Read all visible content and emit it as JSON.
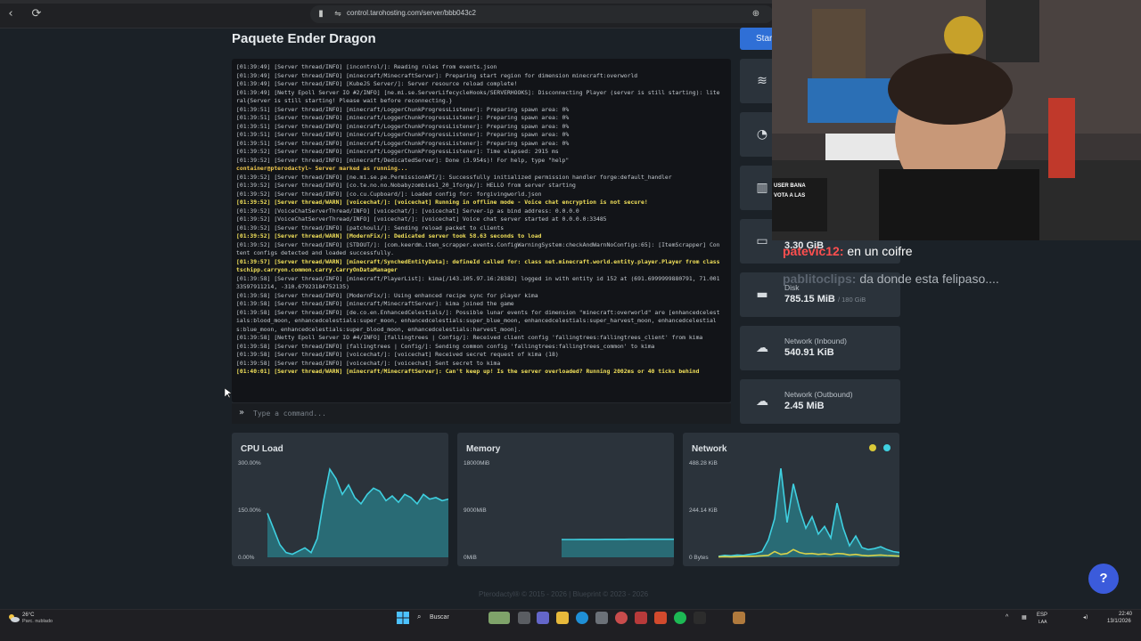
{
  "browser": {
    "url": "control.tarohosting.com/server/bbb043c2"
  },
  "page": {
    "title": "Paquete Ender Dragon",
    "start_label": "Start"
  },
  "console": {
    "lines": [
      {
        "text": "[01:39:49] [Server thread/INFO] [incontrol/]: Reading rules from events.json",
        "type": "info"
      },
      {
        "text": "[01:39:49] [Server thread/INFO] [minecraft/MinecraftServer]: Preparing start region for dimension minecraft:overworld",
        "type": "info"
      },
      {
        "text": "[01:39:49] [Server thread/INFO] [KubeJS Server/]: Server resource reload complete!",
        "type": "info"
      },
      {
        "text": "[01:39:49] [Netty Epoll Server IO #2/INFO] [ne.mi.se.ServerLifecycleHooks/SERVERHOOKS]: Disconnecting Player (server is still starting): literal{Server is still starting! Please wait before reconnecting.}",
        "type": "info"
      },
      {
        "text": "[01:39:51] [Server thread/INFO] [minecraft/LoggerChunkProgressListener]: Preparing spawn area: 0%",
        "type": "info"
      },
      {
        "text": "[01:39:51] [Server thread/INFO] [minecraft/LoggerChunkProgressListener]: Preparing spawn area: 0%",
        "type": "info"
      },
      {
        "text": "[01:39:51] [Server thread/INFO] [minecraft/LoggerChunkProgressListener]: Preparing spawn area: 0%",
        "type": "info"
      },
      {
        "text": "[01:39:51] [Server thread/INFO] [minecraft/LoggerChunkProgressListener]: Preparing spawn area: 0%",
        "type": "info"
      },
      {
        "text": "[01:39:51] [Server thread/INFO] [minecraft/LoggerChunkProgressListener]: Preparing spawn area: 0%",
        "type": "info"
      },
      {
        "text": "[01:39:52] [Server thread/INFO] [minecraft/LoggerChunkProgressListener]: Time elapsed: 2915 ms",
        "type": "info"
      },
      {
        "text": "[01:39:52] [Server thread/INFO] [minecraft/DedicatedServer]: Done (3.954s)! For help, type \"help\"",
        "type": "info"
      },
      {
        "text": "container@pterodactyl~ Server marked as running...",
        "type": "prompt"
      },
      {
        "text": "[01:39:52] [Server thread/INFO] [ne.mi.se.pe.PermissionAPI/]: Successfully initialized permission handler forge:default_handler",
        "type": "info"
      },
      {
        "text": "[01:39:52] [Server thread/INFO] [co.te.no.no.Nobabyzombies1_20_1forge/]: HELLO from server starting",
        "type": "info"
      },
      {
        "text": "[01:39:52] [Server thread/INFO] [co.cu.Cupboard/]: Loaded config for: forgivingworld.json",
        "type": "info"
      },
      {
        "text": "[01:39:52] [Server thread/WARN] [voicechat/]: [voicechat] Running in offline mode - Voice chat encryption is not secure!",
        "type": "warn"
      },
      {
        "text": "[01:39:52] [VoiceChatServerThread/INFO] [voicechat/]: [voicechat] Server-ip as bind address: 0.0.0.0",
        "type": "info"
      },
      {
        "text": "[01:39:52] [VoiceChatServerThread/INFO] [voicechat/]: [voicechat] Voice chat server started at 0.0.0.0:33485",
        "type": "info"
      },
      {
        "text": "[01:39:52] [Server thread/INFO] [patchouli/]: Sending reload packet to clients",
        "type": "info"
      },
      {
        "text": "[01:39:52] [Server thread/WARN] [ModernFix/]: Dedicated server took 58.63 seconds to load",
        "type": "warn"
      },
      {
        "text": "[01:39:52] [Server thread/INFO] [STDOUT/]: [com.keerdm.item_scrapper.events.ConfigWarningSystem:checkAndWarnNoConfigs:65]: [ItemScrapper] Content configs detected and loaded successfully.",
        "type": "info"
      },
      {
        "text": "[01:39:57] [Server thread/WARN] [minecraft/SynchedEntityData]: defineId called for: class net.minecraft.world.entity.player.Player from class tschipp.carryon.common.carry.CarryOnDataManager",
        "type": "warn"
      },
      {
        "text": "[01:39:58] [Server thread/INFO] [minecraft/PlayerList]: kima[/143.105.97.16:28382] logged in with entity id 152 at (691.6999999880791, 71.00133597911214, -310.67923184752135)",
        "type": "info"
      },
      {
        "text": "[01:39:58] [Server thread/INFO] [ModernFix/]: Using enhanced recipe sync for player kima",
        "type": "info"
      },
      {
        "text": "[01:39:58] [Server thread/INFO] [minecraft/MinecraftServer]: kima joined the game",
        "type": "info"
      },
      {
        "text": "[01:39:58] [Server thread/INFO] [de.co.en.EnhancedCelestials/]: Possible lunar events for dimension \"minecraft:overworld\" are [enhancedcelestials:blood_moon, enhancedcelestials:super_moon, enhancedcelestials:super_blue_moon, enhancedcelestials:super_harvest_moon, enhancedcelestials:blue_moon, enhancedcelestials:super_blood_moon, enhancedcelestials:harvest_moon].",
        "type": "info"
      },
      {
        "text": "[01:39:58] [Netty Epoll Server IO #4/INFO] [fallingtrees | Config/]: Received client config 'fallingtrees:fallingtrees_client' from kima",
        "type": "info"
      },
      {
        "text": "[01:39:58] [Server thread/INFO] [fallingtrees | Config/]: Sending common config 'fallingtrees:fallingtrees_common' to kima",
        "type": "info"
      },
      {
        "text": "[01:39:58] [Server thread/INFO] [voicechat/]: [voicechat] Received secret request of kima (18)",
        "type": "info"
      },
      {
        "text": "[01:39:58] [Server thread/INFO] [voicechat/]: [voicechat] Sent secret to kima",
        "type": "info"
      },
      {
        "text": "[01:40:01] [Server thread/WARN] [minecraft/MinecraftServer]: Can't keep up! Is the server overloaded? Running 2002ms or 40 ticks behind",
        "type": "warn"
      }
    ],
    "command_placeholder": "Type a command..."
  },
  "stats": [
    {
      "name": "stat-card-address",
      "icon": "wifi-icon",
      "label": "",
      "value": "",
      "sub": ""
    },
    {
      "name": "stat-card-uptime",
      "icon": "clock-icon",
      "label": "",
      "value": "",
      "sub": ""
    },
    {
      "name": "stat-card-cpu",
      "icon": "chip-icon",
      "label": "",
      "value": "",
      "sub": ""
    },
    {
      "name": "stat-card-memory",
      "icon": "memory-icon",
      "label": "",
      "value": "3.30 GiB",
      "sub": ""
    },
    {
      "name": "stat-card-disk",
      "icon": "hdd-icon",
      "label": "Disk",
      "value": "785.15 MiB",
      "sub": "/ 180 GiB"
    },
    {
      "name": "stat-card-network-in",
      "icon": "cloud-download-icon",
      "label": "Network (Inbound)",
      "value": "540.91 KiB",
      "sub": ""
    },
    {
      "name": "stat-card-network-out",
      "icon": "cloud-upload-icon",
      "label": "Network (Outbound)",
      "value": "2.45 MiB",
      "sub": ""
    }
  ],
  "chart_data": [
    {
      "type": "area",
      "title": "CPU Load",
      "y_ticks": [
        "300.00%",
        "150.00%",
        "0.00%"
      ],
      "ylim": [
        0,
        300
      ],
      "x": [
        0,
        1,
        2,
        3,
        4,
        5,
        6,
        7,
        8,
        9,
        10,
        11,
        12,
        13,
        14,
        15,
        16,
        17,
        18,
        19,
        20,
        21,
        22,
        23,
        24,
        25,
        26,
        27,
        28,
        29
      ],
      "series": [
        {
          "values": [
            140,
            90,
            40,
            15,
            10,
            20,
            30,
            15,
            60,
            180,
            280,
            250,
            200,
            230,
            190,
            170,
            200,
            220,
            210,
            180,
            195,
            175,
            200,
            190,
            170,
            200,
            185,
            190,
            180,
            185
          ]
        }
      ],
      "color": "#3fd0e0"
    },
    {
      "type": "area",
      "title": "Memory",
      "y_ticks": [
        "18000MiB",
        "9000MiB",
        "0MiB"
      ],
      "ylim": [
        0,
        18000
      ],
      "x": [
        0,
        1,
        2,
        3,
        4,
        5,
        6,
        7,
        8,
        9,
        10,
        11,
        12,
        13,
        14,
        15,
        16,
        17,
        18,
        19,
        20,
        21,
        22,
        23,
        24,
        25,
        26,
        27,
        28,
        29
      ],
      "series": [
        {
          "values": [
            null,
            null,
            null,
            null,
            null,
            null,
            null,
            null,
            null,
            null,
            null,
            3400,
            3400,
            3400,
            3420,
            3420,
            3420,
            3420,
            3430,
            3430,
            3430,
            3430,
            3440,
            3440,
            3440,
            3440,
            3450,
            3450,
            3450,
            3450
          ]
        }
      ],
      "color": "#3fd0e0"
    },
    {
      "type": "area",
      "title": "Network",
      "y_ticks": [
        "488.28 KiB",
        "244.14 KiB",
        "0 Bytes"
      ],
      "ylim": [
        0,
        488.28
      ],
      "x": [
        0,
        1,
        2,
        3,
        4,
        5,
        6,
        7,
        8,
        9,
        10,
        11,
        12,
        13,
        14,
        15,
        16,
        17,
        18,
        19,
        20,
        21,
        22,
        23,
        24,
        25,
        26,
        27,
        28,
        29
      ],
      "series": [
        {
          "name": "inbound",
          "values": [
            5,
            10,
            8,
            12,
            10,
            15,
            20,
            30,
            90,
            200,
            460,
            180,
            380,
            250,
            150,
            210,
            120,
            160,
            100,
            280,
            150,
            60,
            110,
            50,
            40,
            45,
            55,
            40,
            30,
            25
          ],
          "color": "#3fd0e0"
        },
        {
          "name": "outbound",
          "values": [
            2,
            3,
            2,
            3,
            4,
            5,
            6,
            8,
            10,
            30,
            15,
            20,
            40,
            25,
            18,
            20,
            15,
            18,
            14,
            20,
            18,
            12,
            15,
            10,
            8,
            10,
            12,
            9,
            8,
            6
          ],
          "color": "#d9d24a"
        }
      ],
      "legend_icons": [
        "download-dot-icon",
        "upload-dot-icon"
      ]
    }
  ],
  "footer": {
    "text": "Pterodactyl® © 2015 - 2026 | Blueprint © 2023 - 2026"
  },
  "chat": [
    {
      "user": "patevic12:",
      "message": "en un coifre",
      "user_color": "#ff4f4f"
    },
    {
      "user": "pablitoclips:",
      "message": "da donde esta felipaso....",
      "user_color": "#5c6570"
    }
  ],
  "webcam_overlay": {
    "line1": "USER BANA",
    "line2": "VOTA A LAS"
  },
  "help_label": "?",
  "taskbar": {
    "temp": "26°C",
    "weather": "Parc. nublado",
    "search": "Buscar",
    "lang": "ESP",
    "lang_sub": "LAA",
    "time": "22:40",
    "date": "13/1/2026"
  }
}
